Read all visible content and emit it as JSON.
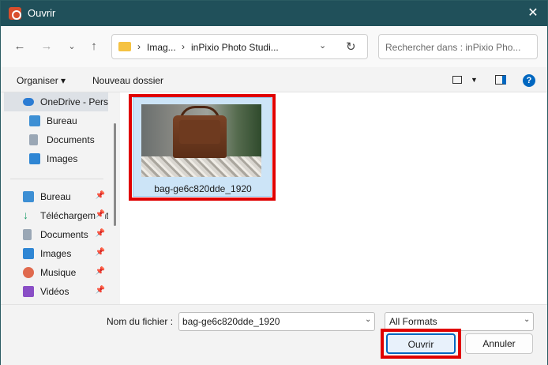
{
  "window": {
    "title": "Ouvrir",
    "close_icon": "close-icon"
  },
  "nav": {
    "breadcrumb": [
      "Imag...",
      "inPixio Photo Studi..."
    ],
    "search_placeholder": "Rechercher dans : inPixio Pho..."
  },
  "toolbar": {
    "organize": "Organiser",
    "new_folder": "Nouveau dossier"
  },
  "sidebar": {
    "items": [
      {
        "label": "OneDrive - Perso",
        "icon": "cloud-icon",
        "selected": true,
        "pinned": false
      },
      {
        "label": "Bureau",
        "icon": "desktop-icon",
        "pinned": false
      },
      {
        "label": "Documents",
        "icon": "document-icon",
        "pinned": false
      },
      {
        "label": "Images",
        "icon": "image-icon",
        "pinned": false
      },
      {
        "label": "Bureau",
        "icon": "desktop-icon",
        "pinned": true
      },
      {
        "label": "Téléchargements",
        "icon": "download-icon",
        "pinned": true
      },
      {
        "label": "Documents",
        "icon": "document-icon",
        "pinned": true
      },
      {
        "label": "Images",
        "icon": "image-icon",
        "pinned": true
      },
      {
        "label": "Musique",
        "icon": "music-icon",
        "pinned": true
      },
      {
        "label": "Vidéos",
        "icon": "video-icon",
        "pinned": true
      }
    ]
  },
  "files": [
    {
      "name": "bag-ge6c820dde_1920",
      "selected": true
    }
  ],
  "footer": {
    "filename_label": "Nom du fichier :",
    "filename_value": "bag-ge6c820dde_1920",
    "format": "All Formats",
    "open": "Ouvrir",
    "cancel": "Annuler"
  },
  "colors": {
    "accent": "#0067c0",
    "highlight": "#e00000",
    "titlebar": "#20505a"
  }
}
